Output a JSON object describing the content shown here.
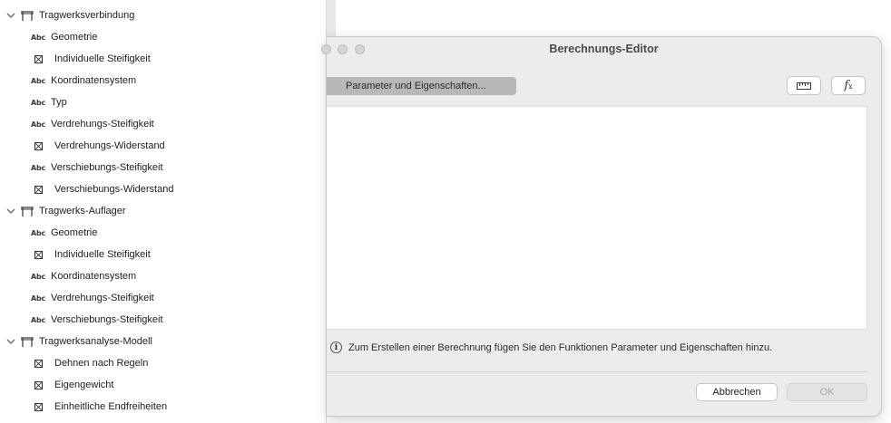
{
  "tree": {
    "groups": [
      {
        "label": "Tragwerksverbindung",
        "items": [
          {
            "type": "abc",
            "label": "Geometrie"
          },
          {
            "type": "check",
            "label": "Individuelle Steifigkeit"
          },
          {
            "type": "abc",
            "label": "Koordinatensystem"
          },
          {
            "type": "abc",
            "label": "Typ"
          },
          {
            "type": "abc",
            "label": "Verdrehungs-Steifigkeit"
          },
          {
            "type": "check",
            "label": "Verdrehungs-Widerstand"
          },
          {
            "type": "abc",
            "label": "Verschiebungs-Steifigkeit"
          },
          {
            "type": "check",
            "label": "Verschiebungs-Widerstand"
          }
        ]
      },
      {
        "label": "Tragwerks-Auflager",
        "items": [
          {
            "type": "abc",
            "label": "Geometrie"
          },
          {
            "type": "check",
            "label": "Individuelle Steifigkeit"
          },
          {
            "type": "abc",
            "label": "Koordinatensystem"
          },
          {
            "type": "abc",
            "label": "Verdrehungs-Steifigkeit"
          },
          {
            "type": "abc",
            "label": "Verschiebungs-Steifigkeit"
          }
        ]
      },
      {
        "label": "Tragwerksanalyse-Modell",
        "items": [
          {
            "type": "check",
            "label": "Dehnen nach Regeln"
          },
          {
            "type": "check",
            "label": "Eigengewicht"
          },
          {
            "type": "check",
            "label": "Einheitliche Endfreiheiten"
          }
        ]
      }
    ],
    "abc_text": "Abc",
    "icons": {
      "group": "structure-frame-icon",
      "abc": "text-type-icon",
      "check": "boolean-checkbox-icon",
      "chevron": "chevron-down-icon"
    }
  },
  "dialog": {
    "title": "Berechnungs-Editor",
    "param_button": "Parameter und Eigenschaften...",
    "tools": [
      {
        "icon": "ruler-icon"
      },
      {
        "icon": "function-icon",
        "text": "f"
      }
    ],
    "info_text": "Zum Erstellen einer Berechnung fügen Sie den Funktionen Parameter und Eigenschaften hinzu.",
    "info_glyph": "i",
    "cancel_label": "Abbrechen",
    "ok_label": "OK"
  }
}
